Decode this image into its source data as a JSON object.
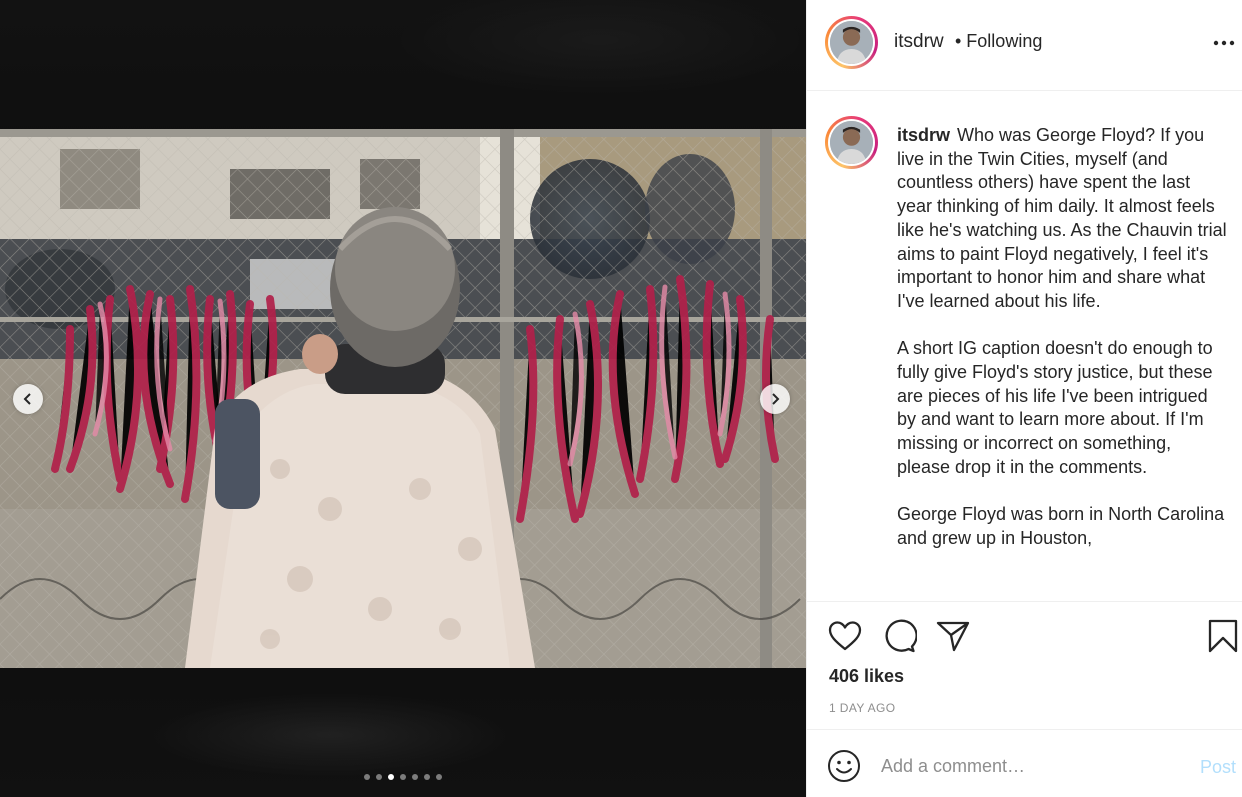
{
  "post": {
    "username": "itsdrw",
    "follow_status": "• Following",
    "more_icon": "more-options-icon",
    "media": {
      "carousel_count": 7,
      "carousel_active_index": 2,
      "prev_icon": "chevron-left-icon",
      "next_icon": "chevron-right-icon"
    },
    "caption": {
      "username": "itsdrw",
      "paragraphs": [
        "Who was George Floyd? If you live in the Twin Cities, myself (and countless others) have spent the last year thinking of him daily. It almost feels like he's watching us. As the Chauvin trial aims to paint Floyd negatively, I feel it's important to honor him and share what I've learned about his life.",
        "A short IG caption doesn't do enough to fully give Floyd's story justice, but these are pieces of his life I've been intrigued by and want to learn more about. If I'm missing or incorrect on something, please drop it in the comments.",
        "George Floyd was born in North Carolina and grew up in Houston,"
      ]
    },
    "actions": {
      "like_icon": "heart-icon",
      "comment_icon": "comment-icon",
      "share_icon": "paper-plane-icon",
      "save_icon": "bookmark-icon"
    },
    "likes": "406 likes",
    "time_ago": "1 DAY AGO",
    "comment_box": {
      "emoji_icon": "smiley-icon",
      "placeholder": "Add a comment…",
      "post_label": "Post"
    },
    "colors": {
      "text": "#262626",
      "muted": "#8e8e8e",
      "post_disabled": "#b2dffc",
      "divider": "#efefef"
    }
  }
}
